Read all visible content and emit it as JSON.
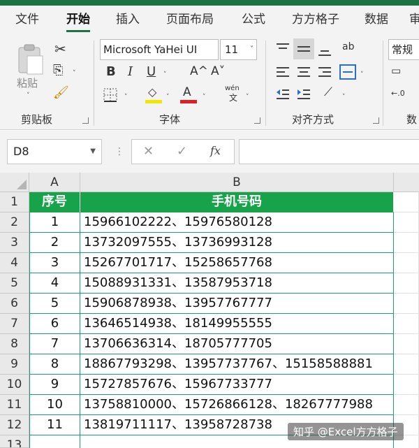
{
  "menu": {
    "tabs": [
      "文件",
      "开始",
      "插入",
      "页面布局",
      "公式",
      "方方格子",
      "数据",
      "审"
    ],
    "active_index": 1
  },
  "ribbon": {
    "clipboard": {
      "paste_label": "粘贴",
      "group_label": "剪贴板"
    },
    "font": {
      "font_name": "Microsoft YaHei UI",
      "font_size": "11",
      "bold": "B",
      "italic": "I",
      "underline": "U",
      "grow": "A^",
      "shrink": "A˅",
      "phonetic": "wén",
      "phonetic_sub": "文",
      "fill_letter": "◇",
      "font_color_letter": "A",
      "group_label": "字体"
    },
    "alignment": {
      "wrap_icon": "ab",
      "group_label": "对齐方式"
    },
    "number": {
      "format": "常规",
      "group_label": "数"
    },
    "colors": {
      "fill": "#f2e600",
      "font_color": "#e02020",
      "accent": "#1e7145"
    }
  },
  "formula_bar": {
    "name_box": "D8",
    "cancel": "✕",
    "enter": "✓",
    "fx": "fx",
    "formula": ""
  },
  "sheet": {
    "columns": [
      "A",
      "B"
    ],
    "header": {
      "a": "序号",
      "b": "手机号码"
    },
    "rows": [
      {
        "n": "1",
        "a": "1",
        "b": "15966102222、15976580128"
      },
      {
        "n": "2",
        "a": "1",
        "b": ""
      },
      {
        "n": "3",
        "a": "2",
        "b": "13732097555、13736993128"
      },
      {
        "n": "4",
        "a": "3",
        "b": "15267701717、15258657768"
      },
      {
        "n": "5",
        "a": "4",
        "b": "15088931331、13587953718"
      },
      {
        "n": "6",
        "a": "5",
        "b": "15906878938、13957767777"
      },
      {
        "n": "7",
        "a": "6",
        "b": "13646514938、18149955555"
      },
      {
        "n": "8",
        "a": "7",
        "b": "13706636314、18705777705"
      },
      {
        "n": "9",
        "a": "8",
        "b": "18867793298、13957737767、15158588881"
      },
      {
        "n": "10",
        "a": "9",
        "b": "15727857676、15967733777"
      },
      {
        "n": "11",
        "a": "10",
        "b": "13758810000、15726866128、18267777988"
      },
      {
        "n": "12",
        "a": "11",
        "b": "13819711117、13958728738"
      }
    ],
    "partial_row_number": "13"
  },
  "watermark": "知乎 @Excel方方格子"
}
